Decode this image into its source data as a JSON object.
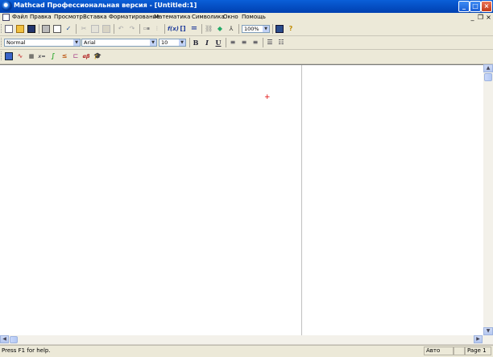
{
  "window": {
    "title": "Mathcad Профессиональная версия - [Untitled:1]",
    "buttons": {
      "minimize": "_",
      "maximize": "□",
      "close": "×"
    }
  },
  "menubar": {
    "items": [
      "Файл",
      "Правка",
      "Просмотр",
      "Вставка",
      "Форматирование",
      "Математика",
      "Символика",
      "Окно",
      "Помощь"
    ],
    "mdi_buttons": {
      "minimize": "_",
      "restore": "❐",
      "close": "×"
    }
  },
  "standard_toolbar": {
    "icons": [
      "new-icon",
      "open-icon",
      "save-icon",
      "print-icon",
      "print-preview-icon",
      "spell-check-icon",
      "cut-icon",
      "copy-icon",
      "paste-icon",
      "undo-icon",
      "redo-icon",
      "align-across-icon",
      "align-down-icon",
      "insert-function-icon",
      "insert-unit-icon",
      "calculate-icon",
      "insert-hyperlink-icon",
      "insert-component-icon",
      "resource-center-icon",
      "help-icon"
    ],
    "zoom": "100%"
  },
  "formatting_toolbar": {
    "style": "Normal",
    "font": "Arial",
    "size": "10",
    "bold": "B",
    "italic": "I",
    "underline": "U"
  },
  "math_toolbar": {
    "icons": [
      "calculator-icon",
      "graph-icon",
      "matrix-icon",
      "evaluation-icon",
      "calculus-icon",
      "boolean-icon",
      "programming-icon",
      "greek-icon",
      "symbolic-icon"
    ],
    "evaluation_label": "x=",
    "greek_label": "αβ"
  },
  "statusbar": {
    "help_text": "Press F1 for help.",
    "mode": "Авто",
    "page": "Page 1"
  }
}
